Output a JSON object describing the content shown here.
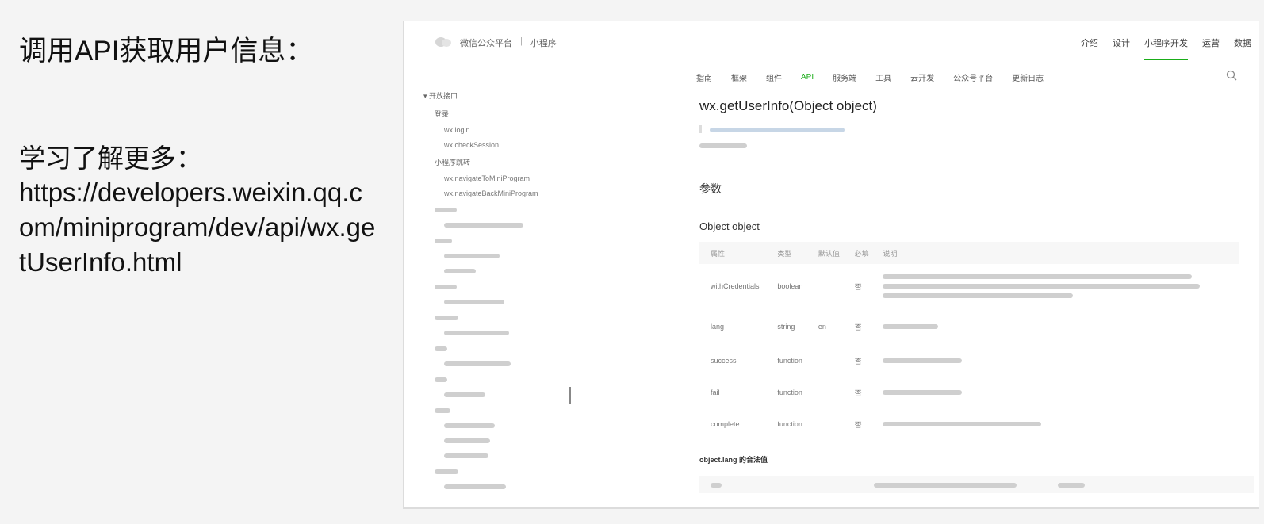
{
  "slide": {
    "title": "调用API获取用户信息：",
    "learn_more": "学习了解更多：",
    "url": "https://developers.weixin.qq.com/miniprogram/dev/api/wx.getUserInfo.html"
  },
  "embedded": {
    "brand": {
      "name": "微信公众平台",
      "section": "小程序"
    },
    "topnav": [
      "介绍",
      "设计",
      "小程序开发",
      "运营",
      "数据"
    ],
    "subnav": [
      "指南",
      "框架",
      "组件",
      "API",
      "服务端",
      "工具",
      "云开发",
      "公众号平台",
      "更新日志"
    ],
    "sidebar": {
      "root": "开放接口",
      "groups": [
        {
          "label": "登录",
          "items": [
            "wx.login",
            "wx.checkSession"
          ]
        },
        {
          "label": "小程序跳转",
          "items": [
            "wx.navigateToMiniProgram",
            "wx.navigateBackMiniProgram"
          ]
        }
      ]
    },
    "api_title": "wx.getUserInfo(Object object)",
    "params_heading": "参数",
    "object_heading": "Object object",
    "table": {
      "headers": [
        "属性",
        "类型",
        "默认值",
        "必填",
        "说明"
      ],
      "rows": [
        {
          "name": "withCredentials",
          "type": "boolean",
          "default": "",
          "required": "否",
          "desc": ""
        },
        {
          "name": "lang",
          "type": "string",
          "default": "en",
          "required": "否",
          "desc": ""
        },
        {
          "name": "success",
          "type": "function",
          "default": "",
          "required": "否",
          "desc": ""
        },
        {
          "name": "fail",
          "type": "function",
          "default": "",
          "required": "否",
          "desc": ""
        },
        {
          "name": "complete",
          "type": "function",
          "default": "",
          "required": "否",
          "desc": ""
        }
      ]
    },
    "sub_heading": "object.lang 的合法值",
    "icon_names": [
      "wechat-logo-icon",
      "search-icon",
      "chevron-down-icon"
    ],
    "accent": "#1aad19"
  }
}
